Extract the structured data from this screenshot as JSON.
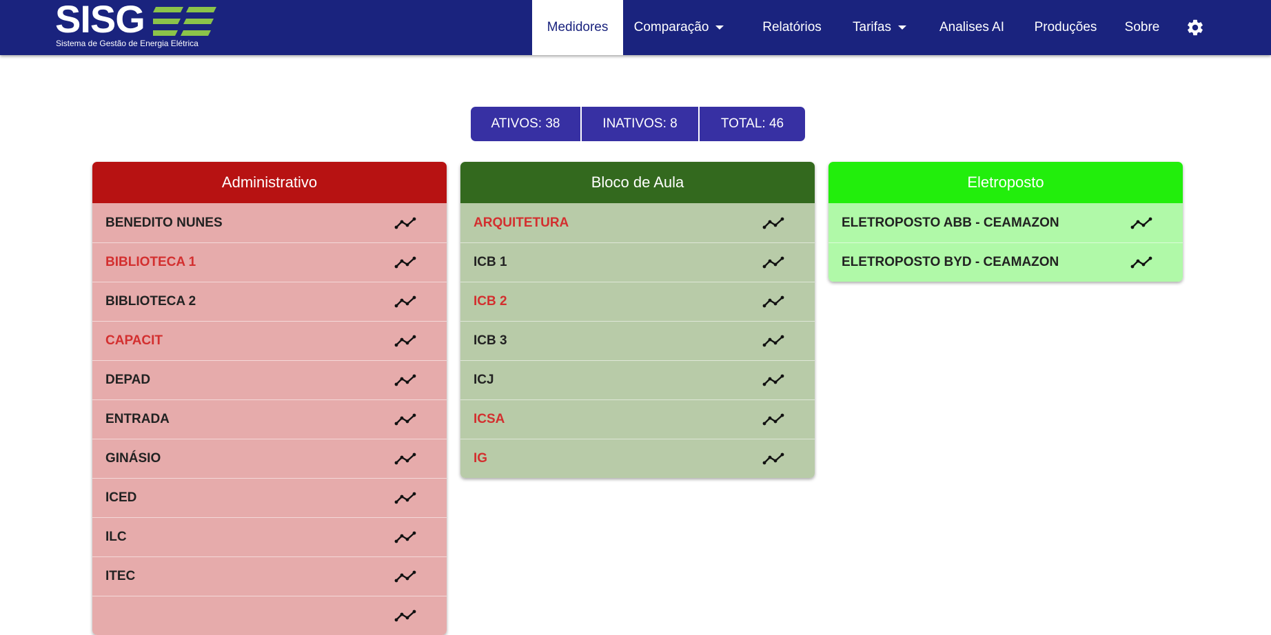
{
  "brand": {
    "name": "SISG",
    "subtitle": "Sistema de Gestão de Energia Elétrica",
    "accent_color": "#8bc34a",
    "navbar_color": "#1a237e"
  },
  "nav": {
    "medidores": "Medidores",
    "comparacao": "Comparação",
    "relatorios": "Relatórios",
    "tarifas": "Tarifas",
    "analises": "Analises AI",
    "producoes": "Produções",
    "sobre": "Sobre",
    "settings_icon": "gear-icon"
  },
  "stats": {
    "ativos": "ATIVOS: 38",
    "inativos": "INATIVOS: 8",
    "total": "TOTAL: 46"
  },
  "groups": {
    "admin": {
      "title": "Administrativo",
      "header_color": "#b71212",
      "items": [
        {
          "label": "BENEDITO NUNES",
          "inactive": false
        },
        {
          "label": "BIBLIOTECA 1",
          "inactive": true
        },
        {
          "label": "BIBLIOTECA 2",
          "inactive": false
        },
        {
          "label": "CAPACIT",
          "inactive": true
        },
        {
          "label": "DEPAD",
          "inactive": false
        },
        {
          "label": "ENTRADA",
          "inactive": false
        },
        {
          "label": "GINÁSIO",
          "inactive": false
        },
        {
          "label": "ICED",
          "inactive": false
        },
        {
          "label": "ILC",
          "inactive": false
        },
        {
          "label": "ITEC",
          "inactive": false
        },
        {
          "label": "",
          "inactive": false
        }
      ]
    },
    "bloco": {
      "title": "Bloco de Aula",
      "header_color": "#33691e",
      "items": [
        {
          "label": "ARQUITETURA",
          "inactive": true
        },
        {
          "label": "ICB 1",
          "inactive": false
        },
        {
          "label": "ICB 2",
          "inactive": true
        },
        {
          "label": "ICB 3",
          "inactive": false
        },
        {
          "label": "ICJ",
          "inactive": false
        },
        {
          "label": "ICSA",
          "inactive": true
        },
        {
          "label": "IG",
          "inactive": true
        }
      ]
    },
    "eletro": {
      "title": "Eletroposto",
      "header_color": "#22ee0c",
      "items": [
        {
          "label": "ELETROPOSTO ABB - CEAMAZON",
          "inactive": false
        },
        {
          "label": "ELETROPOSTO BYD - CEAMAZON",
          "inactive": false
        }
      ]
    }
  },
  "row_icon": "trend-line-icon"
}
